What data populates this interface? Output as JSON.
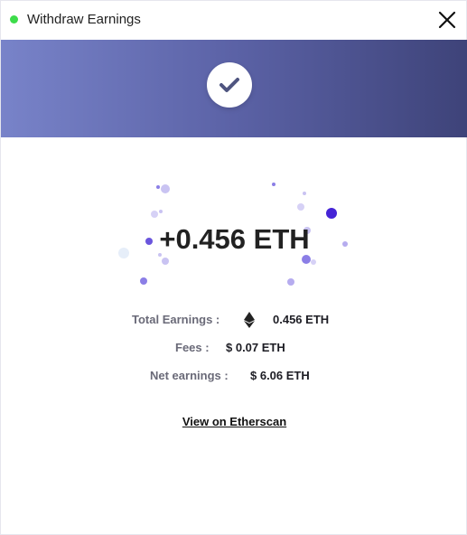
{
  "window": {
    "title": "Withdraw Earnings",
    "status_color": "#3ddc4a"
  },
  "banner": {
    "gradient_colors": [
      "#7883c9",
      "#3e4379"
    ],
    "icon": "check-icon"
  },
  "result": {
    "amount": "+0.456 ETH"
  },
  "summary": {
    "total_label": "Total Earnings :",
    "total_value": "0.456 ETH",
    "total_icon": "ethereum-icon",
    "fees_label": "Fees :",
    "fees_value": "$ 0.07 ETH",
    "net_label": "Net earnings :",
    "net_value": "$ 6.06 ETH"
  },
  "actions": {
    "etherscan_link": "View on Etherscan"
  }
}
